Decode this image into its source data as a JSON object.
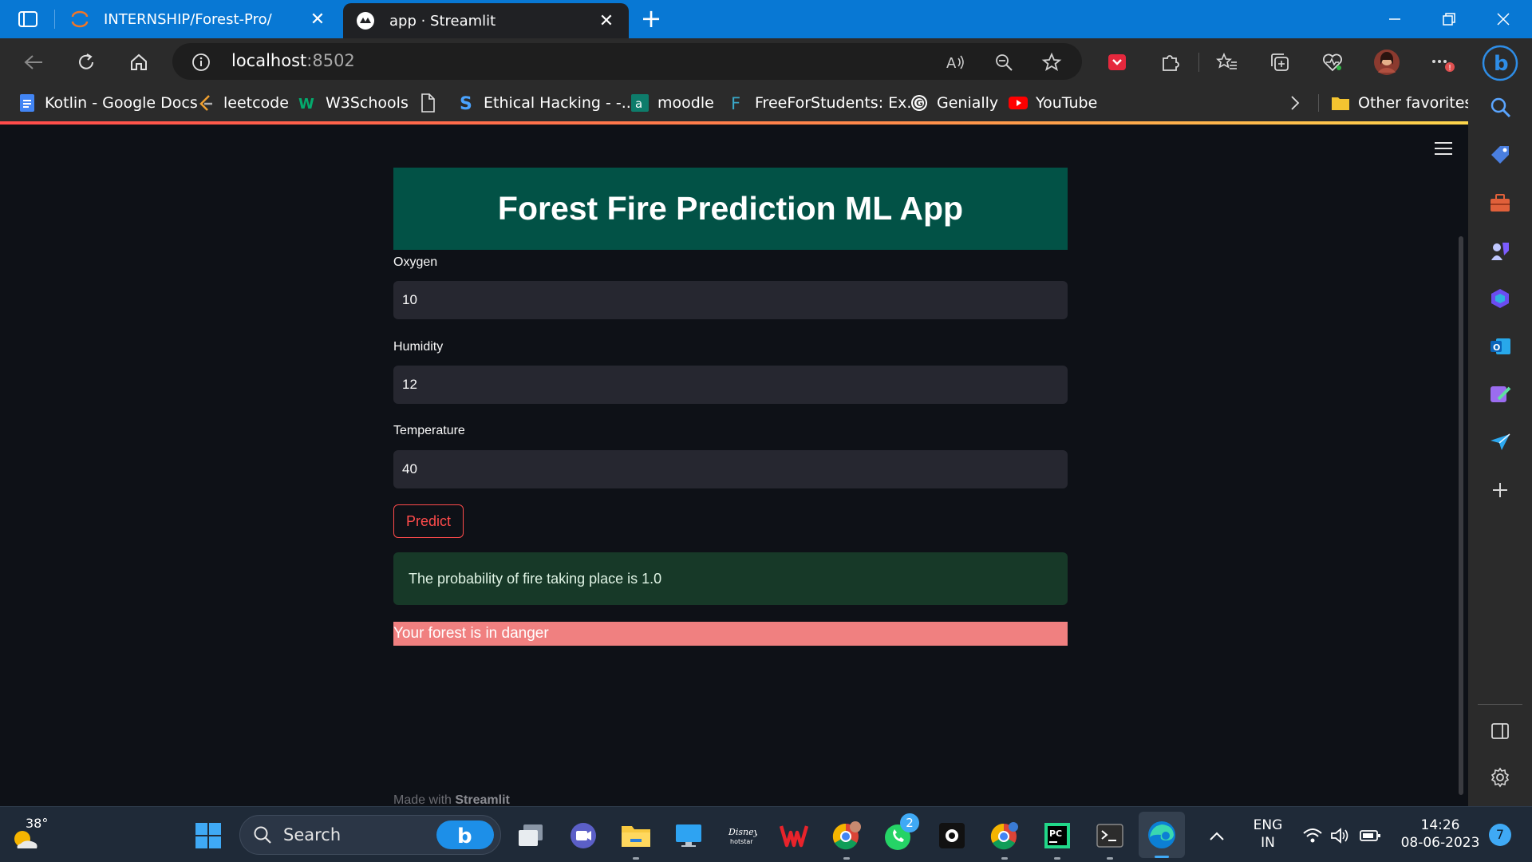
{
  "browser": {
    "tabs": [
      {
        "title": "INTERNSHIP/Forest-Pro/",
        "icon": "jupyter-icon",
        "active": false
      },
      {
        "title": "app · Streamlit",
        "icon": "streamlit-icon",
        "active": true
      }
    ],
    "url_host": "localhost",
    "url_port": ":8502",
    "bookmarks": [
      {
        "label": "Kotlin - Google Docs",
        "icon": "google-docs-icon"
      },
      {
        "label": "leetcode",
        "icon": "leetcode-icon"
      },
      {
        "label": "W3Schools",
        "icon": "w3schools-icon"
      },
      {
        "label": "",
        "icon": "document-icon"
      },
      {
        "label": "Ethical Hacking - -...",
        "icon": "skillshare-icon"
      },
      {
        "label": "moodle",
        "icon": "moodle-icon"
      },
      {
        "label": "FreeForStudents: Ex...",
        "icon": "freeforstudents-icon"
      },
      {
        "label": "Genially",
        "icon": "genially-icon"
      },
      {
        "label": "YouTube",
        "icon": "youtube-icon"
      }
    ],
    "other_favorites": "Other favorites"
  },
  "app": {
    "title": "Forest Fire Prediction ML App",
    "fields": [
      {
        "label": "Oxygen",
        "value": "10"
      },
      {
        "label": "Humidity",
        "value": "12"
      },
      {
        "label": "Temperature",
        "value": "40"
      }
    ],
    "predict_label": "Predict",
    "success_message": "The probability of fire taking place is 1.0",
    "danger_message": "Your forest is in danger",
    "footer_prefix": "Made with ",
    "footer_brand": "Streamlit"
  },
  "taskbar": {
    "weather_temp": "38°",
    "search_placeholder": "Search",
    "whatsapp_badge": "2",
    "language_line1": "ENG",
    "language_line2": "IN",
    "time": "14:26",
    "date": "08-06-2023",
    "notification_count": "7"
  },
  "colors": {
    "header_bg": "#025246",
    "danger_bg": "#f08080",
    "success_bg": "#173928",
    "accent": "#ff4b4b",
    "titlebar": "#0878d4"
  }
}
